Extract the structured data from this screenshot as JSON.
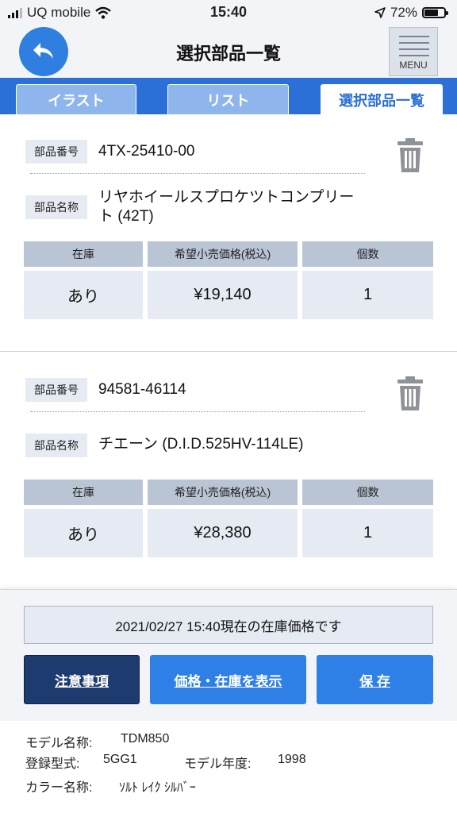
{
  "status": {
    "carrier": "UQ mobile",
    "time": "15:40",
    "battery": "72%",
    "battery_level": 0.72
  },
  "header": {
    "title": "選択部品一覧",
    "menu_label": "MENU"
  },
  "tabs": [
    {
      "label": "イラスト",
      "active": false
    },
    {
      "label": "リスト",
      "active": false
    },
    {
      "label": "選択部品一覧",
      "active": true
    }
  ],
  "labels": {
    "part_number": "部品番号",
    "part_name": "部品名称",
    "stock": "在庫",
    "price": "希望小売価格(税込)",
    "qty": "個数"
  },
  "items": [
    {
      "part_number": "4TX-25410-00",
      "part_name_line1": "リヤホイールスプロケツトコンプリー",
      "part_name_line2": "ト (42T)",
      "stock": "あり",
      "price": "¥19,140",
      "qty": "1"
    },
    {
      "part_number": "94581-46114",
      "part_name_line1": "チエーン (D.I.D.525HV-114LE)",
      "part_name_line2": "",
      "stock": "あり",
      "price": "¥28,380",
      "qty": "1"
    }
  ],
  "bottom": {
    "notice": "2021/02/27 15:40現在の在庫価格です",
    "btn_notes": "注意事項",
    "btn_show": "価格・在庫を表示",
    "btn_save": "保 存"
  },
  "model": {
    "name_label": "モデル名称:",
    "name": "TDM850",
    "type_label": "登録型式:",
    "type": "5GG1",
    "year_label": "モデル年度:",
    "year": "1998",
    "color_label": "カラー名称:",
    "color": "ｿﾙﾄ ﾚｲｸ ｼﾙﾊﾞｰ"
  },
  "colors": {
    "accent": "#2c6fd6",
    "button_blue": "#2f80e6",
    "button_dark": "#1d3b6e"
  }
}
